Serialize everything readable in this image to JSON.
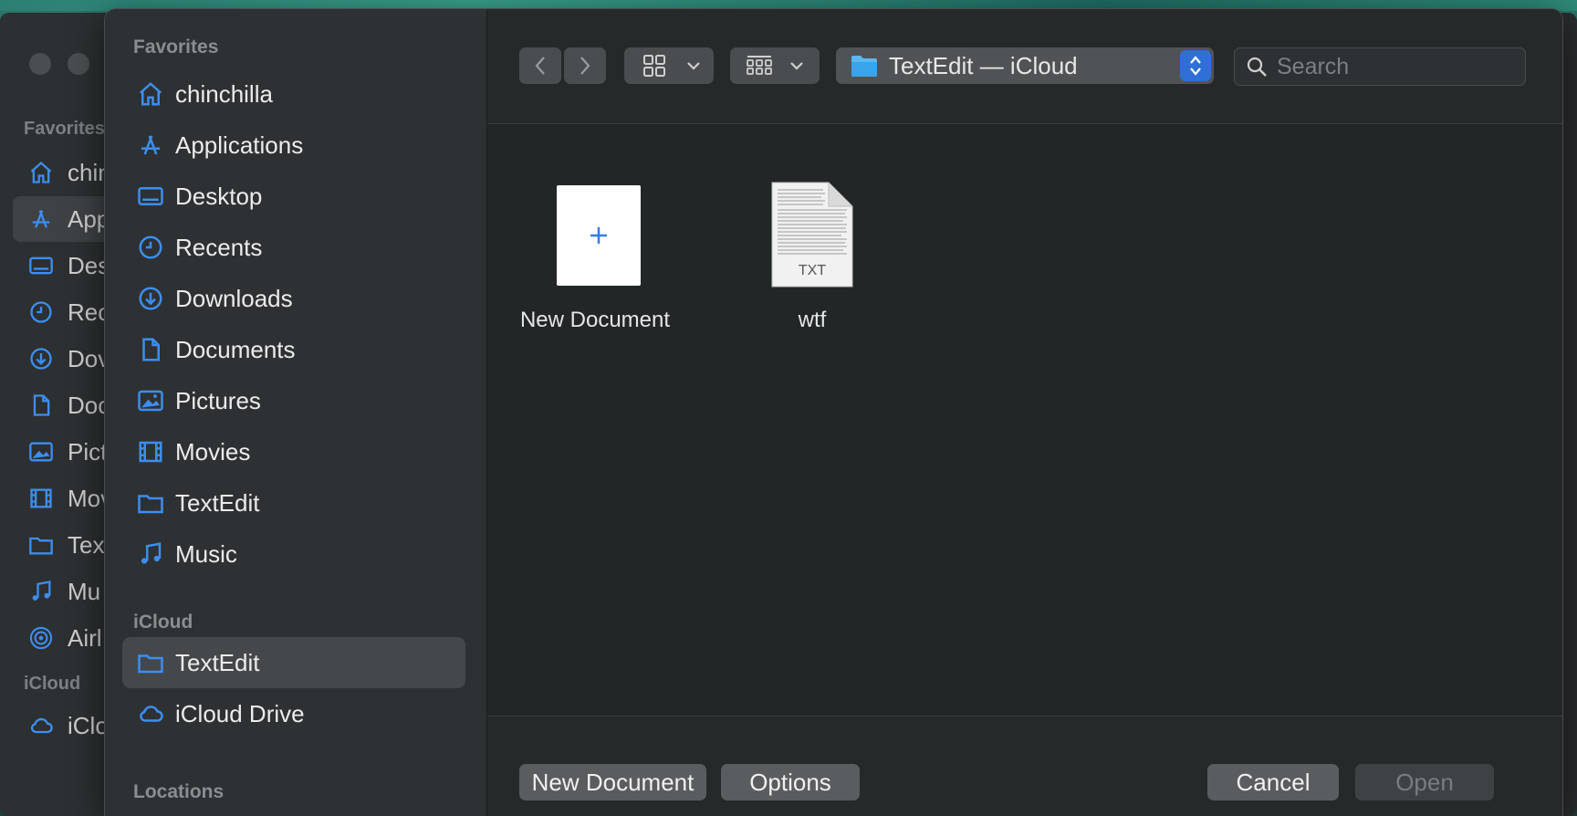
{
  "background_window": {
    "sections": {
      "favorites": "Favorites",
      "icloud": "iCloud"
    },
    "items": [
      {
        "label": "chin",
        "icon": "house-icon"
      },
      {
        "label": "App",
        "icon": "applications-icon"
      },
      {
        "label": "Des",
        "icon": "desktop-icon"
      },
      {
        "label": "Rec",
        "icon": "clock-icon"
      },
      {
        "label": "Dov",
        "icon": "download-icon"
      },
      {
        "label": "Doc",
        "icon": "document-icon"
      },
      {
        "label": "Pict",
        "icon": "photo-icon"
      },
      {
        "label": "Mov",
        "icon": "film-icon"
      },
      {
        "label": "Tex",
        "icon": "folder-icon"
      },
      {
        "label": "Mu",
        "icon": "music-icon"
      },
      {
        "label": "Airl",
        "icon": "airdrop-icon"
      }
    ],
    "icloud_item": "iClo"
  },
  "sidebar": {
    "favorites_header": "Favorites",
    "favorites": [
      {
        "label": "chinchilla",
        "icon": "house-icon"
      },
      {
        "label": "Applications",
        "icon": "applications-icon"
      },
      {
        "label": "Desktop",
        "icon": "desktop-icon"
      },
      {
        "label": "Recents",
        "icon": "clock-icon"
      },
      {
        "label": "Downloads",
        "icon": "download-icon"
      },
      {
        "label": "Documents",
        "icon": "document-icon"
      },
      {
        "label": "Pictures",
        "icon": "photo-icon"
      },
      {
        "label": "Movies",
        "icon": "film-icon"
      },
      {
        "label": "TextEdit",
        "icon": "folder-icon"
      },
      {
        "label": "Music",
        "icon": "music-icon"
      }
    ],
    "icloud_header": "iCloud",
    "icloud": [
      {
        "label": "TextEdit",
        "icon": "folder-icon",
        "selected": true
      },
      {
        "label": "iCloud Drive",
        "icon": "cloud-icon"
      }
    ],
    "locations_header": "Locations"
  },
  "toolbar": {
    "path_label": "TextEdit — iCloud",
    "search_placeholder": "Search"
  },
  "files": [
    {
      "name": "New Document",
      "type": "new-document"
    },
    {
      "name": "wtf",
      "type": "txt",
      "badge": "TXT"
    }
  ],
  "bottom": {
    "new_document": "New Document",
    "options": "Options",
    "cancel": "Cancel",
    "open": "Open"
  },
  "colors": {
    "accent": "#2f7ee6",
    "selected_row": "#44484b"
  }
}
